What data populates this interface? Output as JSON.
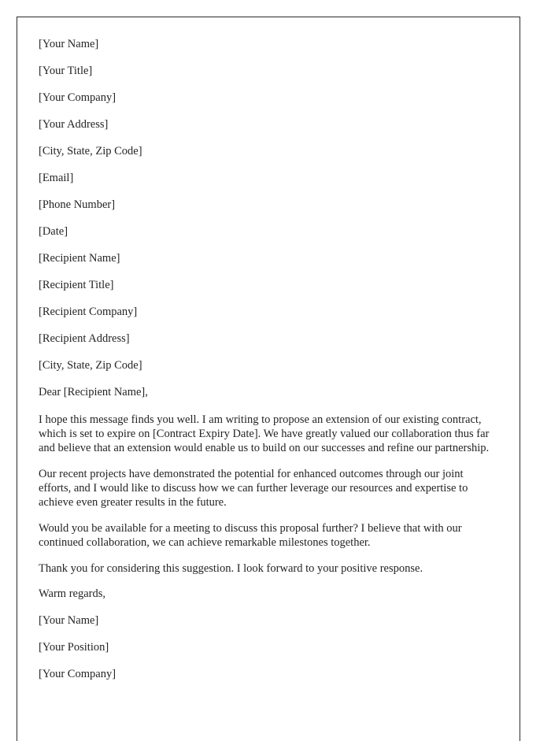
{
  "document": {
    "type": "business-letter",
    "page_border_color": "#2b2b2b",
    "text_color": "#242424",
    "background_color": "#ffffff",
    "letterhead": [
      {
        "text": "[Your Name]"
      },
      {
        "text": "[Your Title]"
      },
      {
        "text": "[Your Company]"
      },
      {
        "text": "[Your Address]"
      },
      {
        "text": "[City, State, Zip Code]"
      },
      {
        "text": "[Email]"
      },
      {
        "text": "[Phone Number]"
      }
    ],
    "date_line": "[Date]",
    "recipient_block": [
      {
        "text": "[Recipient Name]"
      },
      {
        "text": "[Recipient Title]"
      },
      {
        "text": "[Recipient Company]"
      },
      {
        "text": "[Recipient Address]"
      },
      {
        "text": "[City, State, Zip Code]"
      }
    ],
    "salutation": "Dear [Recipient Name],",
    "paragraphs": [
      {
        "text": "I hope this message finds you well. I am writing to propose an extension of our existing contract, which is set to expire on [Contract Expiry Date]. We have greatly valued our collaboration thus far and believe that an extension would enable us to build on our successes and refine our partnership."
      },
      {
        "text": "Our recent projects have demonstrated the potential for enhanced outcomes through our joint efforts, and I would like to discuss how we can further leverage our resources and expertise to achieve even greater results in the future."
      },
      {
        "text": "Would you be available for a meeting to discuss this proposal further? I believe that with our continued collaboration, we can achieve remarkable milestones together."
      },
      {
        "text": "Thank you for considering this suggestion. I look forward to your positive response."
      }
    ],
    "closing": "Warm regards,",
    "signature_block": [
      {
        "text": "[Your Name]"
      },
      {
        "text": "[Your Position]"
      },
      {
        "text": "[Your Company]"
      }
    ]
  }
}
